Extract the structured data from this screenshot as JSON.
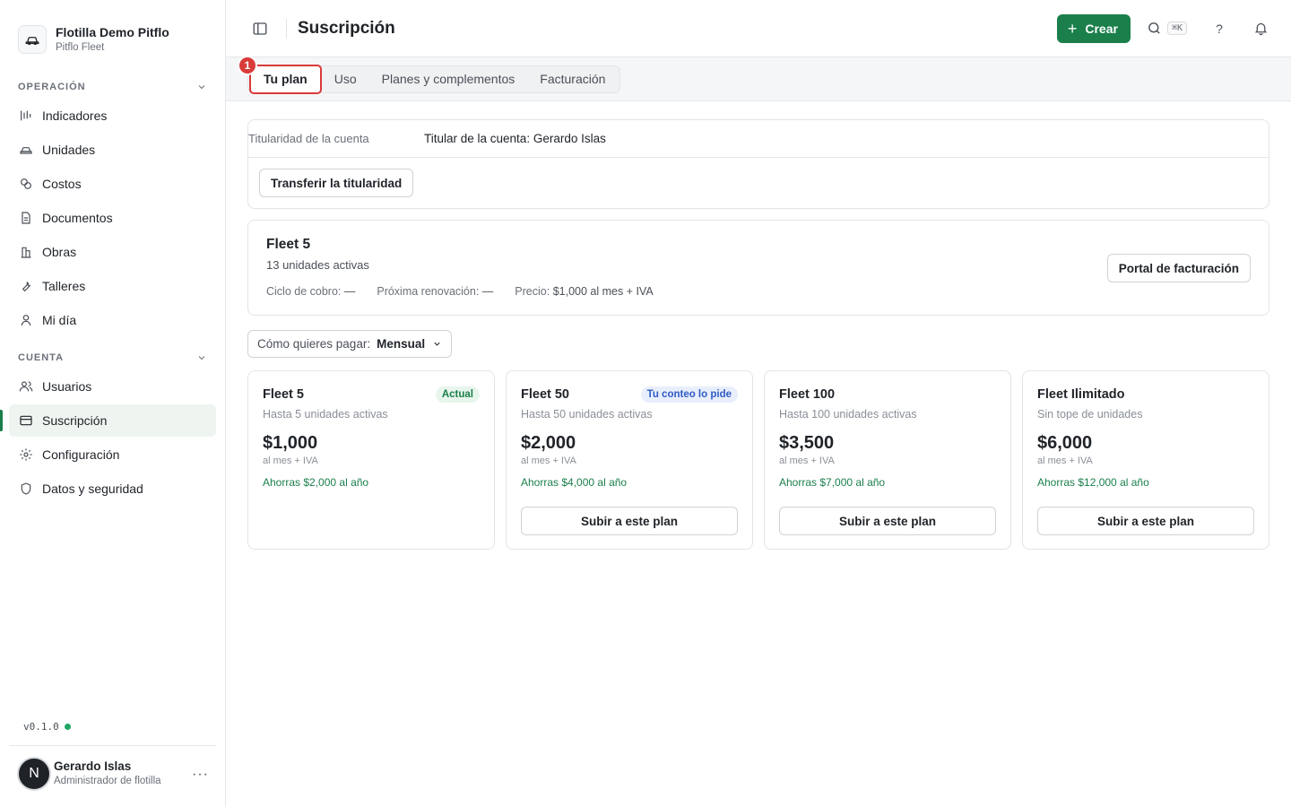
{
  "org": {
    "name": "Flotilla Demo Pitflo",
    "subtitle": "Pitflo Fleet"
  },
  "sections": {
    "operation": "OPERACIÓN",
    "account": "CUENTA"
  },
  "nav_operation": [
    {
      "label": "Indicadores",
      "icon": "chart-icon"
    },
    {
      "label": "Unidades",
      "icon": "car-icon"
    },
    {
      "label": "Costos",
      "icon": "coins-icon"
    },
    {
      "label": "Documentos",
      "icon": "document-icon"
    },
    {
      "label": "Obras",
      "icon": "building-icon"
    },
    {
      "label": "Talleres",
      "icon": "wrench-icon"
    },
    {
      "label": "Mi día",
      "icon": "person-icon"
    }
  ],
  "nav_account": [
    {
      "label": "Usuarios",
      "icon": "users-icon"
    },
    {
      "label": "Suscripción",
      "icon": "card-icon",
      "active": true
    },
    {
      "label": "Configuración",
      "icon": "gear-icon"
    },
    {
      "label": "Datos y seguridad",
      "icon": "shield-icon"
    }
  ],
  "version": "v0.1.0",
  "user": {
    "initial": "N",
    "name": "Gerardo Islas",
    "role": "Administrador de flotilla",
    "more": "···"
  },
  "header": {
    "title": "Suscripción",
    "create_label": "Crear",
    "shortcut": "⌘K",
    "help": "?"
  },
  "tabs": {
    "marker": "1",
    "items": [
      "Tu plan",
      "Uso",
      "Planes y complementos",
      "Facturación"
    ]
  },
  "ownership": {
    "label": "Titularidad de la cuenta",
    "value": "Titular de la cuenta: Gerardo Islas",
    "transfer_label": "Transferir la titularidad"
  },
  "current_plan": {
    "name": "Fleet 5",
    "units": "13 unidades activas",
    "cycle_label": "Ciclo de cobro:",
    "cycle_value": "—",
    "renewal_label": "Próxima renovación:",
    "renewal_value": "—",
    "price_label": "Precio:",
    "price_value": "$1,000 al mes + IVA",
    "portal_label": "Portal de facturación"
  },
  "payment": {
    "label": "Cómo quieres pagar:",
    "value": "Mensual"
  },
  "plans": [
    {
      "name": "Fleet 5",
      "limit": "Hasta 5 unidades activas",
      "price": "$1,000",
      "per": "al mes + IVA",
      "savings": "Ahorras $2,000 al año",
      "badge": "Actual"
    },
    {
      "name": "Fleet 50",
      "limit": "Hasta 50 unidades activas",
      "price": "$2,000",
      "per": "al mes + IVA",
      "savings": "Ahorras $4,000 al año",
      "badge": "Tu conteo lo pide",
      "cta": "Subir a este plan"
    },
    {
      "name": "Fleet 100",
      "limit": "Hasta 100 unidades activas",
      "price": "$3,500",
      "per": "al mes + IVA",
      "savings": "Ahorras $7,000 al año",
      "cta": "Subir a este plan"
    },
    {
      "name": "Fleet Ilimitado",
      "limit": "Sin tope de unidades",
      "price": "$6,000",
      "per": "al mes + IVA",
      "savings": "Ahorras $12,000 al año",
      "cta": "Subir a este plan"
    }
  ],
  "colors": {
    "accent": "#1a7f4b",
    "marker": "#d93a3a",
    "badge_blue": "#2f5cc4"
  }
}
